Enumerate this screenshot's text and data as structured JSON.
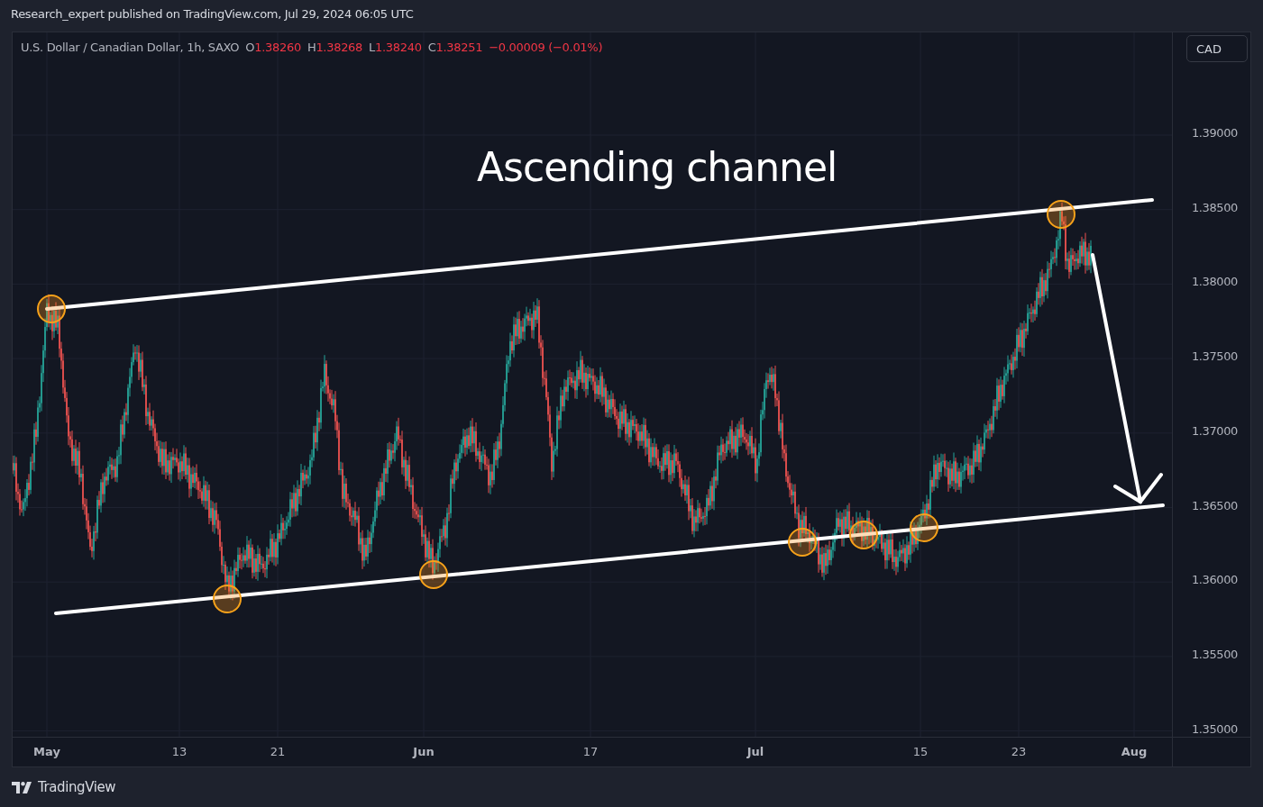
{
  "header": {
    "publisher_line": "Research_expert published on TradingView.com, Jul 29, 2024 06:05 UTC"
  },
  "legend": {
    "symbol": "U.S. Dollar / Canadian Dollar, 1h, SAXO",
    "ohlc": [
      {
        "key": "O",
        "value": "1.38260"
      },
      {
        "key": "H",
        "value": "1.38268"
      },
      {
        "key": "L",
        "value": "1.38240"
      },
      {
        "key": "C",
        "value": "1.38251"
      }
    ],
    "change": "−0.00009 (−0.01%)"
  },
  "currency_button": "CAD",
  "annotation": "Ascending channel",
  "price_axis": [
    "1.39000",
    "1.38500",
    "1.38000",
    "1.37500",
    "1.37000",
    "1.36500",
    "1.36000",
    "1.35500",
    "1.35000"
  ],
  "time_axis": [
    {
      "label": "May",
      "major": true
    },
    {
      "label": "13",
      "major": false
    },
    {
      "label": "21",
      "major": false
    },
    {
      "label": "Jun",
      "major": true
    },
    {
      "label": "17",
      "major": false
    },
    {
      "label": "Jul",
      "major": true
    },
    {
      "label": "15",
      "major": false
    },
    {
      "label": "23",
      "major": false
    },
    {
      "label": "Aug",
      "major": true
    }
  ],
  "footer": {
    "brand": "TradingView"
  }
}
